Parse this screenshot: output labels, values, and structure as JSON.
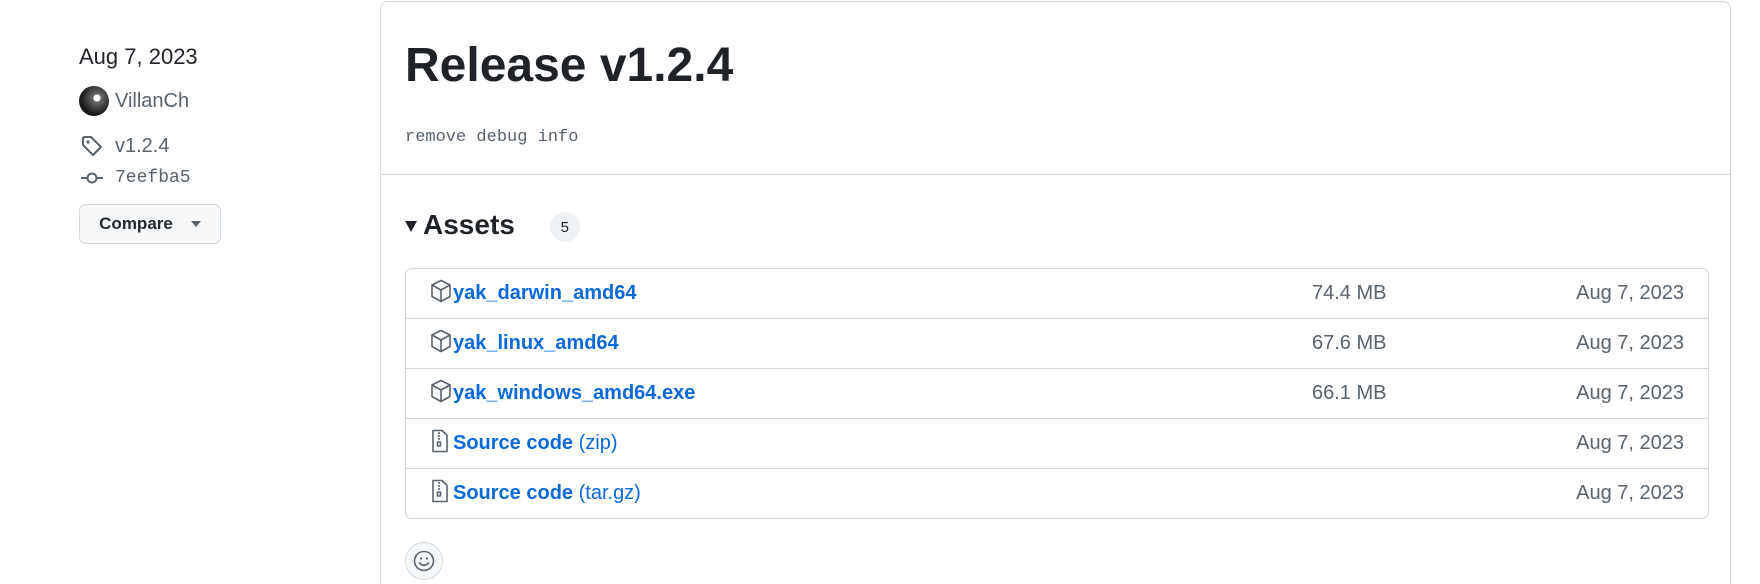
{
  "sidebar": {
    "date": "Aug 7, 2023",
    "author": "VillanCh",
    "tag": "v1.2.4",
    "commit": "7eefba5",
    "compare_label": "Compare"
  },
  "release": {
    "title": "Release v1.2.4",
    "notes": "remove debug info"
  },
  "assets": {
    "title": "Assets",
    "count": "5",
    "items": [
      {
        "name": "yak_darwin_amd64",
        "suffix": "",
        "size": "74.4 MB",
        "date": "Aug 7, 2023",
        "icon": "package-icon"
      },
      {
        "name": "yak_linux_amd64",
        "suffix": "",
        "size": "67.6 MB",
        "date": "Aug 7, 2023",
        "icon": "package-icon"
      },
      {
        "name": "yak_windows_amd64.exe",
        "suffix": "",
        "size": "66.1 MB",
        "date": "Aug 7, 2023",
        "icon": "package-icon"
      },
      {
        "name": "Source code",
        "suffix": "(zip)",
        "size": "",
        "date": "Aug 7, 2023",
        "icon": "file-zip-icon"
      },
      {
        "name": "Source code",
        "suffix": "(tar.gz)",
        "size": "",
        "date": "Aug 7, 2023",
        "icon": "file-zip-icon"
      }
    ]
  },
  "colors": {
    "link": "#0969da",
    "muted": "#59636e",
    "border": "#d1d9e0"
  }
}
